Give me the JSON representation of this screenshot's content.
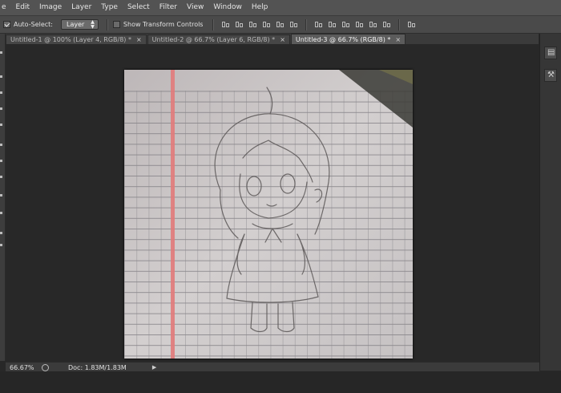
{
  "menubar": {
    "items": [
      "e",
      "Edit",
      "Image",
      "Layer",
      "Type",
      "Select",
      "Filter",
      "View",
      "Window",
      "Help"
    ]
  },
  "options": {
    "auto_select_label": "Auto-Select:",
    "auto_select_checked": true,
    "target_value": "Layer",
    "transform_label": "Show Transform Controls",
    "transform_checked": false
  },
  "tabs": [
    {
      "label": "Untitled-1 @ 100% (Layer 4, RGB/8) *",
      "active": false
    },
    {
      "label": "Untitled-2 @ 66.7% (Layer 6, RGB/8) *",
      "active": false
    },
    {
      "label": "Untitled-3 @ 66.7% (RGB/8) *",
      "active": true
    }
  ],
  "tab_close_glyph": "×",
  "status": {
    "zoom": "66.67%",
    "doc": "Doc: 1.83M/1.83M",
    "arrow_glyph": "▶"
  },
  "colors": {
    "paper": "#cfcbcb",
    "grid": "#7d7b80",
    "margin_line": "#e07878",
    "pencil": "#5a5656"
  },
  "icons": {
    "panel_1": "arrange-icon",
    "panel_2": "tool-presets-icon"
  }
}
